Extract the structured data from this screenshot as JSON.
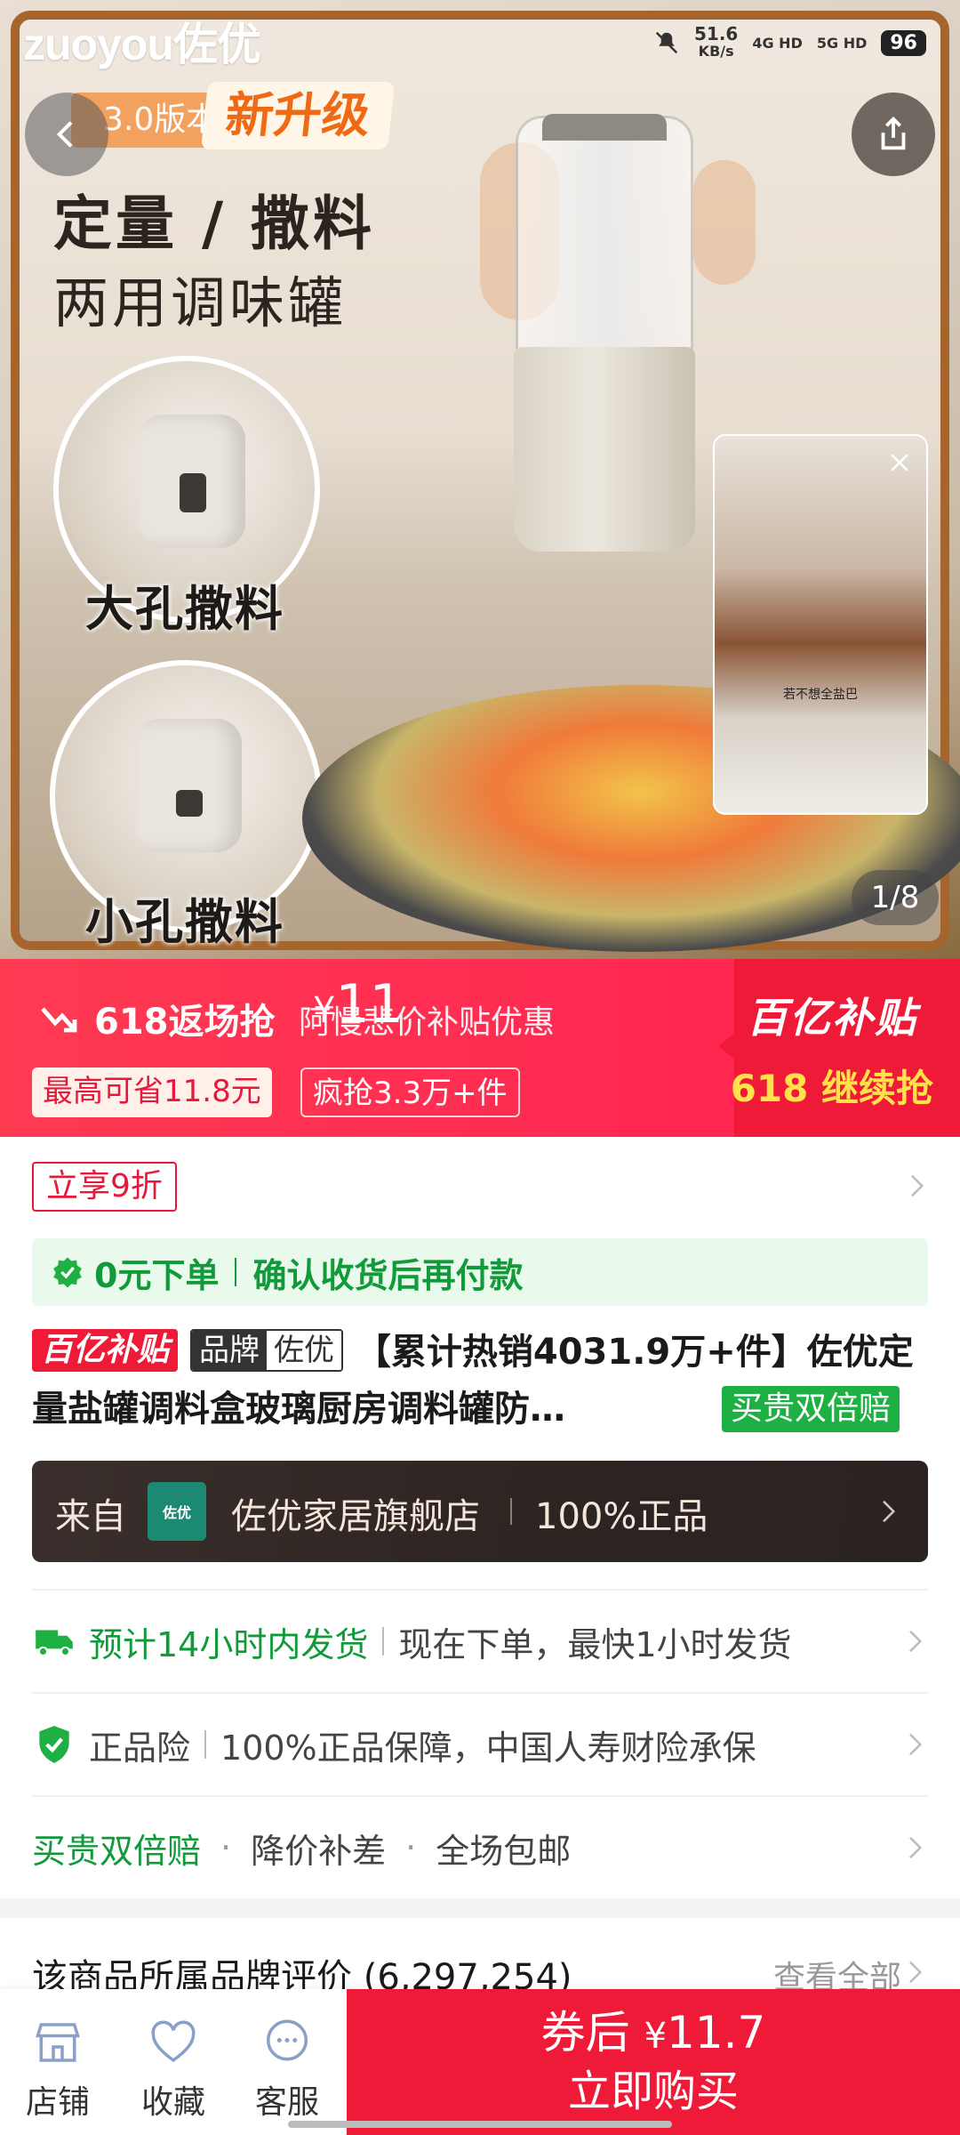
{
  "status_bar": {
    "network_speed": "51.6",
    "speed_unit": "KB/s",
    "sig1": "4G HD",
    "sig2": "5G HD",
    "battery": "96"
  },
  "hero": {
    "brand_logo": "zuoyou佐优",
    "tag_version": "3.0版本",
    "tag_upgrade": "新升级",
    "headline": "定量 / 撒料",
    "subheadline": "两用调味罐",
    "label_big": "大孔撒料",
    "label_small": "小孔撒料",
    "video_caption": "若不想全盐巴",
    "page_indicator": "1/8"
  },
  "promo": {
    "title": "618返场抢",
    "price_prefix": "¥",
    "price": "11",
    "note": "阿慢悲价补贴优惠",
    "chip_save": "最高可省11.8元",
    "chip_rush": "疯抢3.3万+件",
    "brand": "百亿补贴",
    "continue": "618 继续抢"
  },
  "coupon": {
    "label": "立享9折"
  },
  "pay_bar": {
    "text1": "0元下单",
    "text2": "确认收货后再付款"
  },
  "product": {
    "badge_byz": "百亿补贴",
    "badge_brand_a": "品牌",
    "badge_brand_b": "佐优",
    "title": "【累计热销4031.9万+件】佐优定量盐罐调料盒玻璃厨房调料罐防…",
    "badge_double": "买贵双倍赔"
  },
  "store": {
    "from": "来自",
    "logo_text": "佐优",
    "name": "佐优家居旗舰店",
    "auth": "100%正品"
  },
  "shipping": {
    "highlight": "预计14小时内发货",
    "detail": "现在下单，最快1小时发货"
  },
  "insurance": {
    "label": "正品险",
    "detail": "100%正品保障，中国人寿财险承保"
  },
  "guarantee": {
    "item1": "买贵双倍赔",
    "item2": "降价补差",
    "item3": "全场包邮"
  },
  "reviews": {
    "title": "该商品所属品牌评价 (6,297,254)",
    "view_all": "查看全部"
  },
  "bottom_bar": {
    "tabs": [
      {
        "label": "店铺",
        "icon": "store-icon"
      },
      {
        "label": "收藏",
        "icon": "heart-icon"
      },
      {
        "label": "客服",
        "icon": "chat-icon"
      }
    ],
    "buy_line1_prefix": "券后",
    "buy_yen": "¥",
    "buy_price": "11.7",
    "buy_line2": "立即购买"
  },
  "colors": {
    "accent_red": "#ee1a37",
    "green": "#119a3a",
    "store_dark": "#2d2522"
  }
}
